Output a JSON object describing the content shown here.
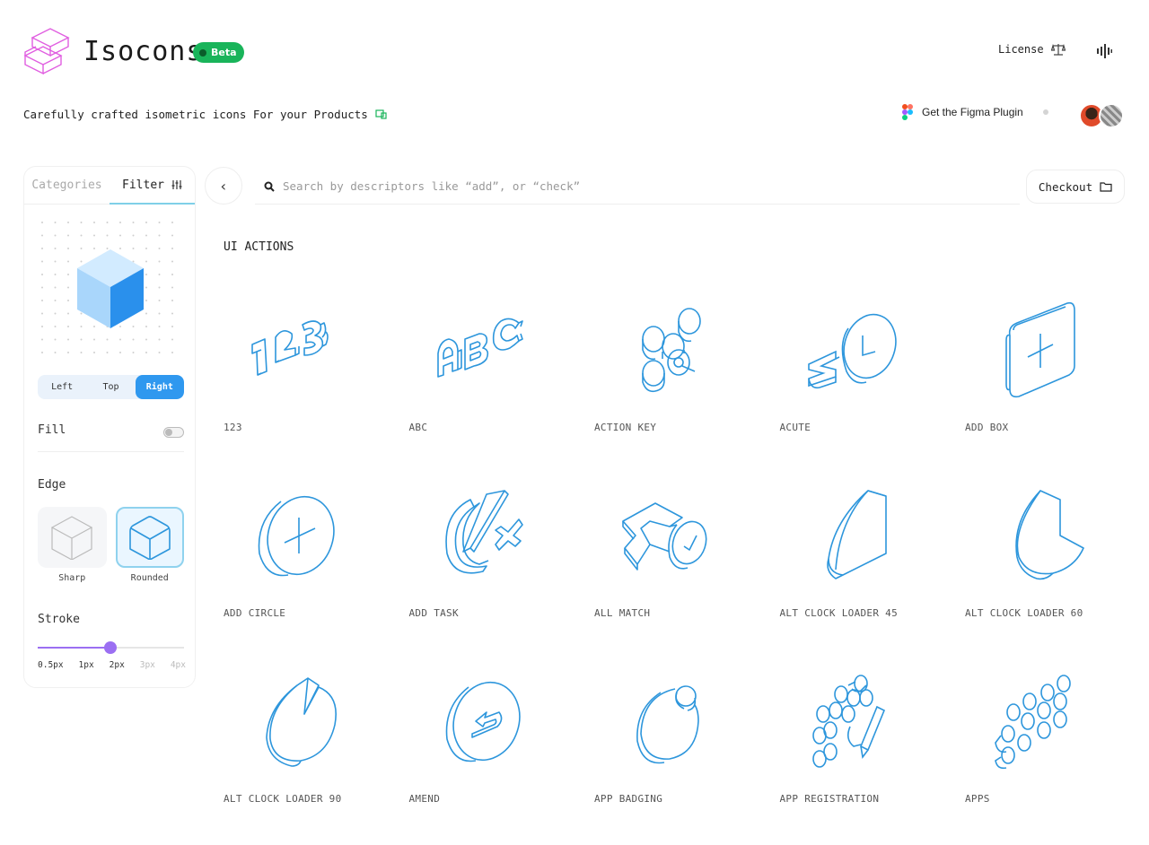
{
  "header": {
    "brand": "Isocons",
    "beta_badge": "Beta",
    "license_label": "License",
    "tagline": "Carefully crafted isometric icons For your Products",
    "figma_label": "Get the Figma Plugin"
  },
  "sidebar": {
    "tabs": [
      {
        "label": "Categories",
        "active": false
      },
      {
        "label": "Filter",
        "active": true
      }
    ],
    "view_options": [
      {
        "label": "Left",
        "active": false
      },
      {
        "label": "Top",
        "active": false
      },
      {
        "label": "Right",
        "active": true
      }
    ],
    "fill_label": "Fill",
    "fill_enabled": false,
    "edge_label": "Edge",
    "edge_options": [
      {
        "label": "Sharp",
        "selected": false
      },
      {
        "label": "Rounded",
        "selected": true
      }
    ],
    "stroke_label": "Stroke",
    "stroke_stops": [
      "0.5px",
      "1px",
      "2px",
      "3px",
      "4px"
    ],
    "stroke_value": "2px"
  },
  "search": {
    "placeholder": "Search by descriptors like “add”, or “check”"
  },
  "checkout_label": "Checkout",
  "section": {
    "title": "UI ACTIONS",
    "icons": [
      {
        "label": "123",
        "icon": "numbers-123-icon"
      },
      {
        "label": "ABC",
        "icon": "letters-abc-icon"
      },
      {
        "label": "ACTION KEY",
        "icon": "action-key-icon"
      },
      {
        "label": "ACUTE",
        "icon": "acute-icon"
      },
      {
        "label": "ADD BOX",
        "icon": "add-box-icon"
      },
      {
        "label": "ADD CIRCLE",
        "icon": "add-circle-icon"
      },
      {
        "label": "ADD TASK",
        "icon": "add-task-icon"
      },
      {
        "label": "ALL MATCH",
        "icon": "all-match-icon"
      },
      {
        "label": "ALT CLOCK LOADER 45",
        "icon": "clock-loader-45-icon"
      },
      {
        "label": "ALT CLOCK LOADER 60",
        "icon": "clock-loader-60-icon"
      },
      {
        "label": "ALT CLOCK LOADER 90",
        "icon": "clock-loader-90-icon"
      },
      {
        "label": "AMEND",
        "icon": "amend-icon"
      },
      {
        "label": "APP BADGING",
        "icon": "app-badging-icon"
      },
      {
        "label": "APP REGISTRATION",
        "icon": "app-registration-icon"
      },
      {
        "label": "APPS",
        "icon": "apps-icon"
      }
    ]
  },
  "colors": {
    "accent": "#2f98ef",
    "icon_stroke": "#2d96dc",
    "beta": "#19b45a",
    "slider": "#9b6ff2",
    "logo": "#e05ee0"
  }
}
